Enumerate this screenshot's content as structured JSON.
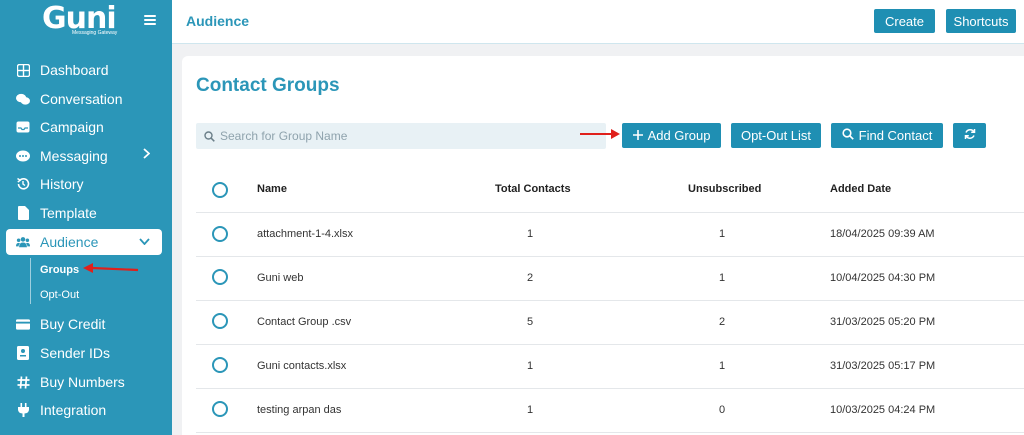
{
  "sidebar": {
    "logo": "Guni",
    "logo_subtitle": "Messaging Gateway",
    "items": [
      {
        "label": "Dashboard",
        "icon": "grid-icon"
      },
      {
        "label": "Conversation",
        "icon": "chat-bubbles-icon"
      },
      {
        "label": "Campaign",
        "icon": "inbox-icon"
      },
      {
        "label": "Messaging",
        "icon": "message-icon"
      },
      {
        "label": "History",
        "icon": "history-icon"
      },
      {
        "label": "Template",
        "icon": "document-icon"
      },
      {
        "label": "Audience",
        "icon": "users-icon"
      },
      {
        "label": "Buy Credit",
        "icon": "credit-card-icon"
      },
      {
        "label": "Sender IDs",
        "icon": "id-badge-icon"
      },
      {
        "label": "Buy Numbers",
        "icon": "hash-icon"
      },
      {
        "label": "Integration",
        "icon": "plug-icon"
      }
    ],
    "sub_items": [
      {
        "label": "Groups"
      },
      {
        "label": "Opt-Out"
      }
    ]
  },
  "topbar": {
    "title": "Audience",
    "create_label": "Create",
    "shortcuts_label": "Shortcuts"
  },
  "main": {
    "title": "Contact Groups",
    "search_placeholder": "Search for Group Name",
    "add_group_label": "Add Group",
    "opt_out_list_label": "Opt-Out List",
    "find_contact_label": "Find Contact",
    "columns": {
      "name": "Name",
      "total_contacts": "Total Contacts",
      "unsubscribed": "Unsubscribed",
      "added_date": "Added Date"
    },
    "rows": [
      {
        "name": "attachment-1-4.xlsx",
        "total": "1",
        "unsub": "1",
        "date": "18/04/2025 09:39 AM"
      },
      {
        "name": "Guni web",
        "total": "2",
        "unsub": "1",
        "date": "10/04/2025 04:30 PM"
      },
      {
        "name": "Contact Group .csv",
        "total": "5",
        "unsub": "2",
        "date": "31/03/2025 05:20 PM"
      },
      {
        "name": "Guni contacts.xlsx",
        "total": "1",
        "unsub": "1",
        "date": "31/03/2025 05:17 PM"
      },
      {
        "name": "testing arpan das",
        "total": "1",
        "unsub": "0",
        "date": "10/03/2025 04:24 PM"
      }
    ]
  },
  "colors": {
    "accent": "#2b96b8",
    "button": "#1f8fb3",
    "annotation": "#e0201b"
  }
}
